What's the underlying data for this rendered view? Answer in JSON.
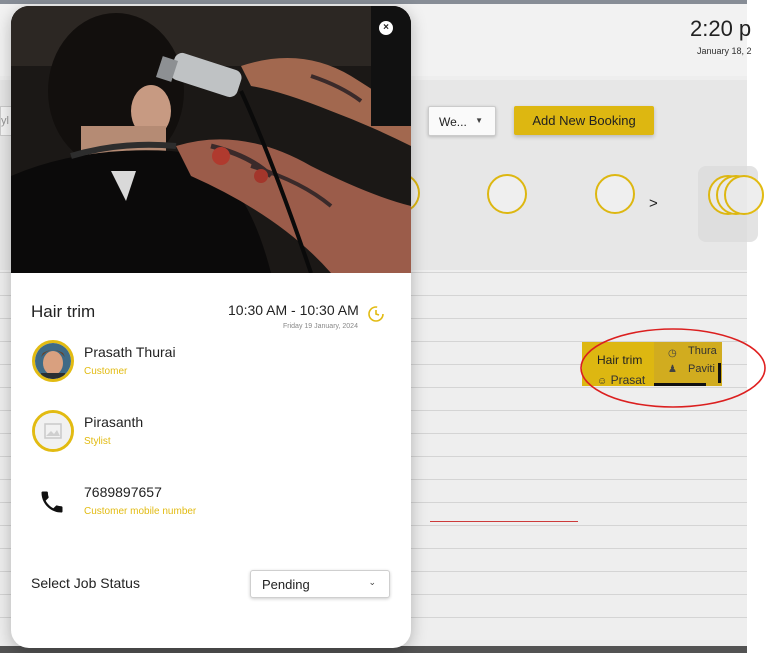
{
  "background": {
    "clock_time": "2:20 p",
    "clock_date": "January 18, 2",
    "left_input_text": "yl",
    "view_select": "We...",
    "add_booking_label": "Add New Booking",
    "booking_card": {
      "title": "Hair trim",
      "customer": "Prasat"
    },
    "booking_card_2": {
      "line1": "Thura",
      "line2": "Paviti"
    }
  },
  "modal": {
    "close_icon": "close-icon",
    "service": "Hair trim",
    "time_range": "10:30 AM - 10:30 AM",
    "date": "Friday 19 January, 2024",
    "customer": {
      "name": "Prasath Thurai",
      "role": "Customer"
    },
    "stylist": {
      "name": "Pirasanth",
      "role": "Stylist"
    },
    "phone": {
      "number": "7689897657",
      "label": "Customer mobile number"
    },
    "status": {
      "label": "Select Job Status",
      "selected": "Pending"
    }
  },
  "colors": {
    "accent": "#e2bb12",
    "annotation": "#e02020"
  }
}
